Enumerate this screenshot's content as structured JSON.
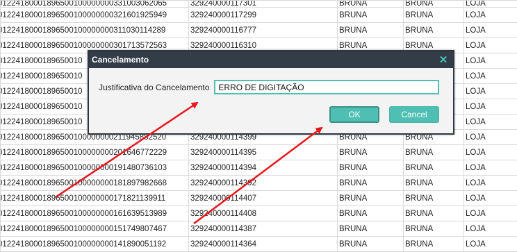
{
  "grid": {
    "rows": [
      [
        "01224180001896500100000000331003062065",
        "329240000117301",
        "BRUNA",
        "BRUNA",
        "LOJA"
      ],
      [
        "01224180001896500100000000321601925949",
        "329240000117299",
        "BRUNA",
        "BRUNA",
        "LOJA"
      ],
      [
        "01224180001896500100000000311030114289",
        "329240000116777",
        "BRUNA",
        "BRUNA",
        "LOJA"
      ],
      [
        "01224180001896500100000000301713572563",
        "329240000116310",
        "BRUNA",
        "BRUNA",
        "LOJA"
      ],
      [
        "0122418000189650010",
        "",
        "",
        "",
        "LOJA"
      ],
      [
        "0122418000189650010",
        "",
        "",
        "",
        "LOJA"
      ],
      [
        "0122418000189650010",
        "",
        "",
        "",
        "LOJA"
      ],
      [
        "0122418000189650010",
        "",
        "",
        "",
        "LOJA"
      ],
      [
        "0122418000189650010",
        "",
        "",
        "",
        "LOJA"
      ],
      [
        "01224180001896500100000000211945882520",
        "329240000114399",
        "BRUNA",
        "BRUNA",
        "LOJA"
      ],
      [
        "01224180001896500100000000201646772229",
        "329240000114395",
        "BRUNA",
        "BRUNA",
        "LOJA"
      ],
      [
        "01224180001896500100000000191480736103",
        "329240000114394",
        "BRUNA",
        "BRUNA",
        "LOJA"
      ],
      [
        "01224180001896500100000000181897982668",
        "329240000114392",
        "BRUNA",
        "BRUNA",
        "LOJA"
      ],
      [
        "01224180001896500100000000171821139911",
        "329240000114407",
        "BRUNA",
        "BRUNA",
        "LOJA"
      ],
      [
        "01224180001896500100000000161639513989",
        "329240000114408",
        "BRUNA",
        "BRUNA",
        "LOJA"
      ],
      [
        "01224180001896500100000000151749807467",
        "329240000114387",
        "BRUNA",
        "BRUNA",
        "LOJA"
      ],
      [
        "01224180001896500100000000141890051192",
        "329240000114364",
        "BRUNA",
        "BRUNA",
        "LOJA"
      ]
    ]
  },
  "dialog": {
    "title": "Cancelamento",
    "close_icon": "close-icon",
    "label": "Justificativa do Cancelamento",
    "input_value": "ERRO DE DIGITAÇÃO",
    "ok_label": "OK",
    "cancel_label": "Cancel"
  },
  "colors": {
    "dialog_header": "#333d47",
    "accent": "#4fbfb3",
    "annotation_arrow": "#e8151b",
    "grid_line": "#d9d9d9"
  }
}
